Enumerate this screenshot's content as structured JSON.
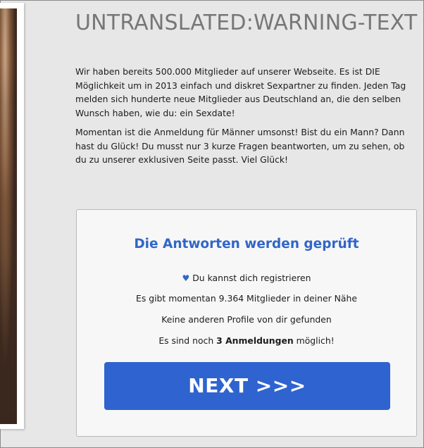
{
  "page": {
    "title": "UNTRANSLATED:WARNING-TEXT",
    "paragraphs": [
      "Wir haben bereits 500.000 Mitglieder auf unserer Webseite. Es ist DIE Möglichkeit um in 2013 einfach und diskret Sexpartner zu finden. Jeden Tag melden sich hunderte neue Mitglieder aus Deutschland an, die den selben Wunsch haben, wie du: ein Sexdate!",
      "Momentan ist die Anmeldung für Männer umsonst! Bist du ein Mann? Dann hast du Glück! Du musst nur 3 kurze Fragen beantworten, um zu sehen, ob du zu unserer exklusiven Seite passt. Viel Glück!"
    ]
  },
  "panel": {
    "title": "Die Antworten werden geprüft",
    "heart_icon": "heart-icon",
    "status_registered": "Du kannst dich registrieren",
    "status_members": "Es gibt momentan 9.364 Mitglieder in deiner Nähe",
    "status_profiles": "Keine anderen Profile von dir gefunden",
    "slots_prefix": "Es sind noch",
    "slots_bold": "3 Anmeldungen",
    "slots_suffix": "möglich!",
    "next_label": "NEXT >>>"
  },
  "colors": {
    "accent": "#3166c8",
    "button": "#2f63cf",
    "title_gray": "#777777",
    "background": "#e7e7e7"
  }
}
